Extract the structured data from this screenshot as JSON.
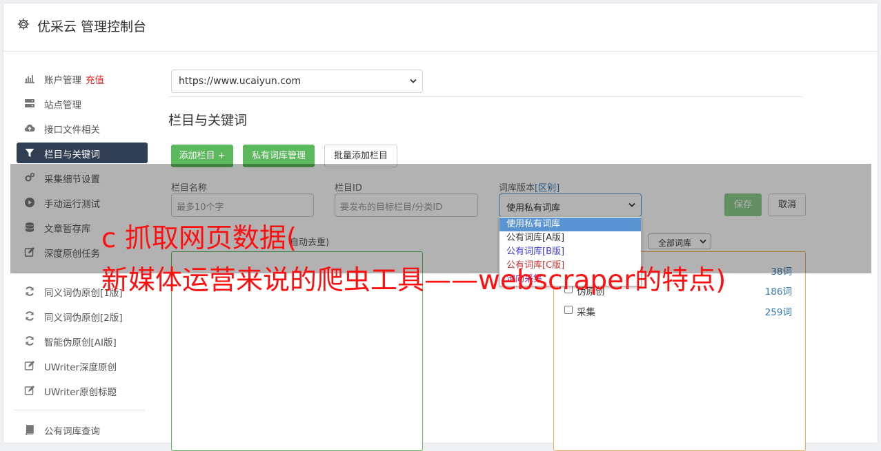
{
  "app": {
    "title": "优采云 管理控制台"
  },
  "sidebar": {
    "items": [
      {
        "label": "账户管理",
        "badge": "充值",
        "icon": "bar-chart-icon"
      },
      {
        "label": "站点管理",
        "icon": "server-icon"
      },
      {
        "label": "接口文件相关",
        "icon": "cloud-upload-icon"
      },
      {
        "label": "栏目与关键词",
        "icon": "filter-icon",
        "active": true
      },
      {
        "label": "采集细节设置",
        "icon": "cogs-icon"
      },
      {
        "label": "手动运行测试",
        "icon": "play-circle-icon"
      },
      {
        "label": "文章暂存库",
        "icon": "database-icon"
      },
      {
        "label": "深度原创任务",
        "icon": "edit-icon"
      },
      {
        "label": "同义词伪原创[1版]",
        "icon": "refresh-icon"
      },
      {
        "label": "同义词伪原创[2版]",
        "icon": "refresh-icon"
      },
      {
        "label": "智能伪原创[AI版]",
        "icon": "refresh-icon"
      },
      {
        "label": "UWriter深度原创",
        "icon": "edit-icon"
      },
      {
        "label": "UWriter原创标题",
        "icon": "edit-icon"
      },
      {
        "label": "公有词库查询",
        "icon": "book-icon"
      }
    ]
  },
  "site_select": {
    "value": "https://www.ucaiyun.com"
  },
  "section": {
    "title": "栏目与关键词"
  },
  "toolbar": {
    "add_label": "添加栏目 +",
    "private_lib_label": "私有词库管理",
    "batch_add_label": "批量添加栏目"
  },
  "form": {
    "name_label": "栏目名称",
    "name_placeholder": "最多10个字",
    "id_label": "栏目ID",
    "id_placeholder": "要发布的目标栏目/分类ID",
    "version_label": "词库版本",
    "version_link": "[区别]",
    "version_value": "使用私有词库",
    "save_label": "保存",
    "cancel_label": "取消",
    "keywords_label_partial": "自动去重)",
    "filter_value": "全部词库"
  },
  "version_options": [
    {
      "label": "使用私有词库",
      "color": "#ffffff",
      "selected": true
    },
    {
      "label": "公有词库[A版]",
      "color": "#333333"
    },
    {
      "label": "公有词库[B版]",
      "color": "#3b3bd0"
    },
    {
      "label": "公有词库[C版]",
      "color": "#cc3333"
    },
    {
      "label": "定向采集",
      "color": "#9a2fa5"
    }
  ],
  "libraries": [
    {
      "name": "",
      "count": "38词"
    },
    {
      "name": "伪原创",
      "count": "186词"
    },
    {
      "name": "采集",
      "count": "259词"
    }
  ],
  "watermark": {
    "line1": "c 抓取网页数据(",
    "line2": "新媒体运营来说的爬虫工具——webscraper的特点)"
  },
  "colors": {
    "accent_green": "#5cb85c",
    "sidebar_active": "#2f3e53",
    "link_blue": "#337ab7",
    "badge_red": "#e02020",
    "watermark_red": "#ff1010"
  }
}
